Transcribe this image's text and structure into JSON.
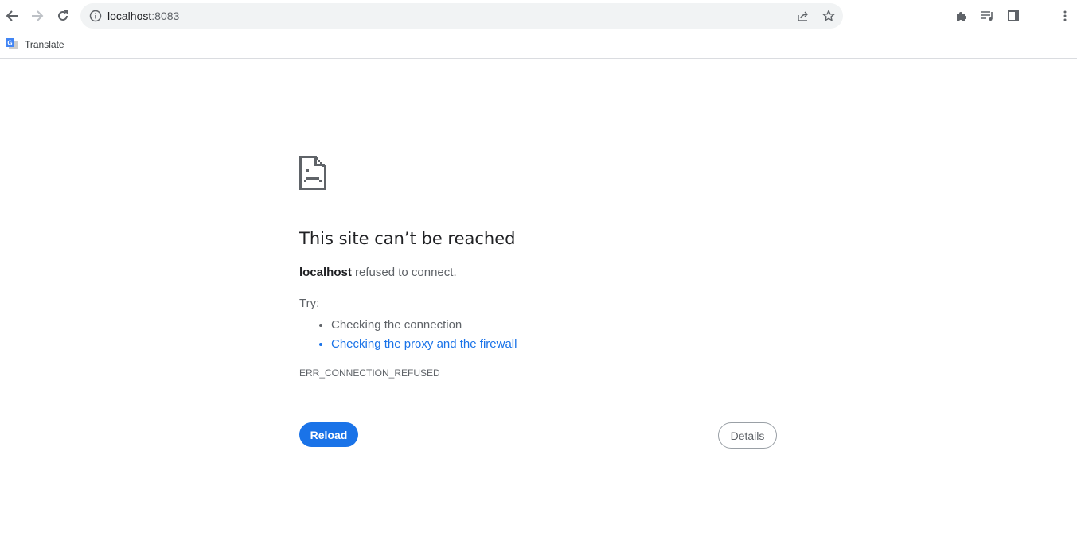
{
  "browser": {
    "url_host": "localhost",
    "url_port": ":8083",
    "bookmarks": [
      {
        "label": "Translate"
      }
    ],
    "accent": "#1a73e8"
  },
  "error": {
    "title": "This site can’t be reached",
    "host": "localhost",
    "message": " refused to connect.",
    "try_label": "Try:",
    "suggestions": [
      "Checking the connection",
      "Checking the proxy and the firewall"
    ],
    "code": "ERR_CONNECTION_REFUSED",
    "reload_label": "Reload",
    "details_label": "Details"
  }
}
